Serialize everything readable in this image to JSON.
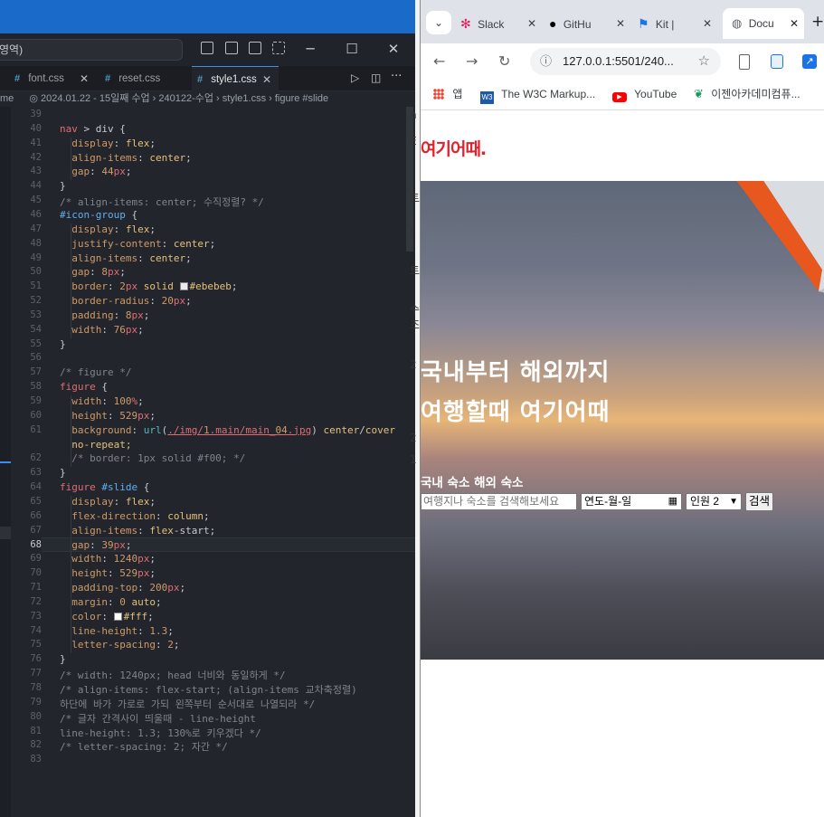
{
  "vscode": {
    "command_center": "영역)",
    "tabs": [
      {
        "name": "font.css",
        "active": false
      },
      {
        "name": "reset.css",
        "active": false
      },
      {
        "name": "style1.css",
        "active": true
      }
    ],
    "breadcrumb": "2024.01.22 - 15일째 수업 › 240122-수업 › style1.css › figure #slide",
    "breadcrumb_prefix": "me",
    "current_line": "68",
    "line_numbers": [
      "39",
      "40",
      "41",
      "42",
      "43",
      "44",
      "45",
      "46",
      "47",
      "48",
      "49",
      "50",
      "51",
      "52",
      "53",
      "54",
      "55",
      "56",
      "57",
      "58",
      "59",
      "60",
      "61",
      "",
      "62",
      "63",
      "64",
      "65",
      "66",
      "67",
      "68",
      "69",
      "70",
      "71",
      "72",
      "73",
      "74",
      "75",
      "76",
      "77",
      "78",
      "79",
      "80",
      "81",
      "82",
      "83"
    ],
    "code_lines": [
      "",
      "nav > div {",
      "  display: flex;",
      "  align-items: center;",
      "  gap: 44px;",
      "}",
      "/* align-items: center; 수직정렬? */",
      "#icon-group {",
      "  display: flex;",
      "  justify-content: center;",
      "  align-items: center;",
      "  gap: 8px;",
      "  border: 2px solid ■#ebebeb;",
      "  border-radius: 20px;",
      "  padding: 8px;",
      "  width: 76px;",
      "}",
      "",
      "/* figure */",
      "figure {",
      "  width: 100%;",
      "  height: 529px;",
      "  background: url(./img/1.main/main_04.jpg) center/cover",
      "  no-repeat;",
      "  /* border: 1px solid #f00; */",
      "}",
      "figure #slide {",
      "  display: flex;",
      "  flex-direction: column;",
      "  align-items: flex-start;",
      "  gap: 39px;",
      "  width: 1240px;",
      "  height: 529px;",
      "  padding-top: 200px;",
      "  margin: 0 auto;",
      "  color: ■#fff;",
      "  line-height: 1.3;",
      "  letter-spacing: 2;",
      "}",
      "/* width: 1240px; head 너비와 동일하게 */",
      "/* align-items: flex-start; (align-items 교차축정렬)",
      "하단에 바가 가로로 가되 왼쪽부터 순서대로 나열되라 */",
      "/* 글자 간격사이 띄울때 - line-height",
      "line-height: 1.3; 130%로 키우겠다 */",
      "/* letter-spacing: 2; 자간 */",
      ""
    ]
  },
  "chrome": {
    "tabs": [
      {
        "label": "Slack",
        "active": false
      },
      {
        "label": "GitHu",
        "active": false
      },
      {
        "label": "Kit |",
        "active": false
      },
      {
        "label": "Docu",
        "active": true
      }
    ],
    "url": "127.0.0.1:5501/240...",
    "bookmarks": [
      {
        "label": "앱"
      },
      {
        "label": "The W3C Markup..."
      },
      {
        "label": "YouTube"
      },
      {
        "label": "이젠아카데미컴퓨..."
      }
    ],
    "page": {
      "logo": "여기어때.",
      "headline_1": "국내부터 해외까지",
      "headline_2": "여행할때 여기어때",
      "category_domestic": "국내 숙소",
      "category_overseas": "해외 숙소",
      "search_placeholder": "여행지나 숙소를 검색해보세요",
      "date_value": "연도-월-일",
      "people_value": "인원 2",
      "search_button": "검색"
    }
  },
  "colors": {
    "brand_red": "#e5202b",
    "vscode_bg": "#22262c",
    "accent_blue": "#3b8eea"
  }
}
